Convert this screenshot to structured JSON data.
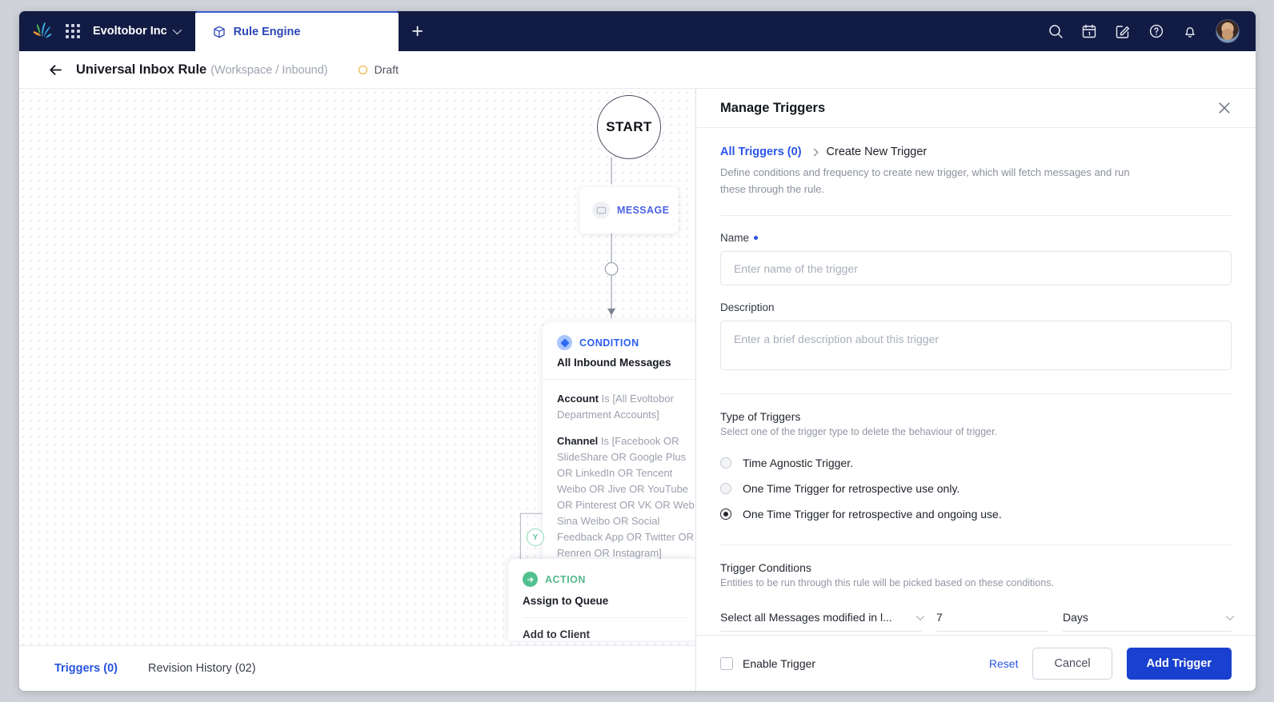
{
  "topnav": {
    "logo_name": "sprinklr-logo",
    "apps_icon": "apps-grid-icon",
    "org": "Evoltobor Inc",
    "tab": {
      "label": "Rule Engine",
      "icon": "cube-icon"
    },
    "add_tab": "+",
    "icons": [
      "search-icon",
      "calendar-icon",
      "compose-icon",
      "help-icon",
      "bell-icon"
    ]
  },
  "subheader": {
    "back": "back-arrow-icon",
    "title": "Universal Inbox Rule",
    "scope": "(Workspace / Inbound)",
    "status": "Draft"
  },
  "canvas": {
    "start_label": "START",
    "message_node": {
      "label": "MESSAGE"
    },
    "condition_node": {
      "kind": "CONDITION",
      "title": "All Inbound Messages",
      "lines": [
        {
          "key": "Account",
          "value": "Is [All Evoltobor Department Accounts]"
        },
        {
          "key": "Channel",
          "value": "Is [Facebook OR SlideShare OR Google Plus OR LinkedIn OR Tencent Weibo OR Jive OR YouTube OR Pinterest OR VK OR Web Sina Weibo OR Social Feedback App OR Twitter OR Renren OR Instagram]"
        }
      ]
    },
    "branch_badge": "Y",
    "action_node": {
      "kind": "ACTION",
      "title": "Assign to Queue",
      "next_title": "Add to Client"
    },
    "footer_tabs": [
      {
        "label": "Triggers (0)",
        "active": true
      },
      {
        "label": "Revision History (02)",
        "active": false
      }
    ]
  },
  "panel": {
    "title": "Manage Triggers",
    "close": "close-icon",
    "breadcrumb": {
      "link": "All Triggers (0)",
      "current": "Create New Trigger"
    },
    "breadcrumb_desc": "Define conditions and frequency to create new trigger, which will fetch messages and run these through the rule.",
    "name_label": "Name",
    "name_value": "",
    "name_placeholder": "Enter name of the trigger",
    "description_label": "Description",
    "description_value": "",
    "description_placeholder": "Enter a brief description about this trigger",
    "type_title": "Type of Triggers",
    "type_sub": "Select one of the trigger type to delete the behaviour of trigger.",
    "type_options": [
      {
        "label": "Time Agnostic Trigger.",
        "selected": false
      },
      {
        "label": "One Time Trigger for retrospective use only.",
        "selected": false
      },
      {
        "label": "One Time Trigger for retrospective and ongoing use.",
        "selected": true
      }
    ],
    "conditions_title": "Trigger Conditions",
    "conditions_sub": "Entities to be run through this rule will be picked based on these conditions.",
    "condition_select": "Select all Messages modified in l...",
    "condition_number": "7",
    "condition_unit": "Days",
    "footer": {
      "enable_label": "Enable Trigger",
      "enable_checked": false,
      "reset": "Reset",
      "cancel": "Cancel",
      "submit": "Add Trigger"
    }
  },
  "colors": {
    "navy": "#121b43",
    "brand_blue": "#2b55e8",
    "primary_button": "#1a40cf",
    "draft_amber": "#f0a825",
    "action_green": "#52c08e"
  }
}
